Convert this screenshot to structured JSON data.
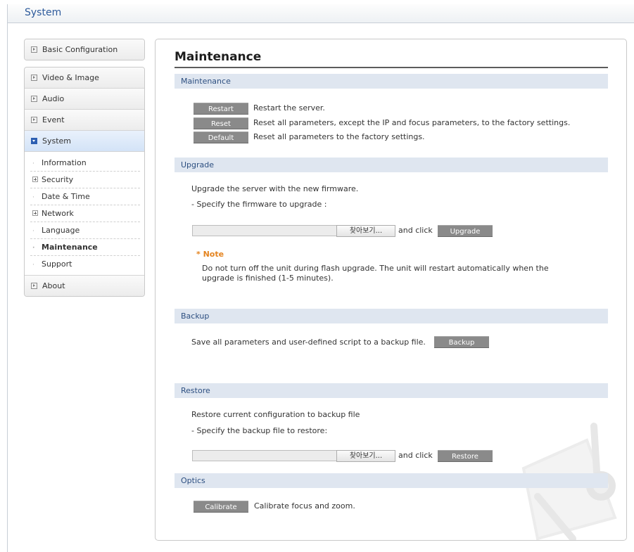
{
  "header": {
    "title": "System"
  },
  "sidebar": {
    "groups": [
      {
        "items": [
          {
            "label": "Basic Configuration"
          }
        ]
      },
      {
        "items": [
          {
            "label": "Video & Image"
          },
          {
            "label": "Audio"
          },
          {
            "label": "Event"
          },
          {
            "label": "System"
          }
        ],
        "submenu": [
          {
            "label": "Information"
          },
          {
            "label": "Security"
          },
          {
            "label": "Date & Time"
          },
          {
            "label": "Network"
          },
          {
            "label": "Language"
          },
          {
            "label": "Maintenance"
          },
          {
            "label": "Support"
          }
        ],
        "after": [
          {
            "label": "About"
          }
        ]
      }
    ]
  },
  "main": {
    "title": "Maintenance",
    "maintenance": {
      "heading": "Maintenance",
      "restart_label": "Restart",
      "restart_desc": "Restart the server.",
      "reset_label": "Reset",
      "reset_desc": "Reset all parameters, except the IP and focus parameters, to the factory settings.",
      "default_label": "Default",
      "default_desc": "Reset all parameters to the factory settings."
    },
    "upgrade": {
      "heading": "Upgrade",
      "line1": "Upgrade the server with the new firmware.",
      "line2": "- Specify the firmware to upgrade :",
      "browse_label": "찾아보기...",
      "and_click": "and click",
      "button_label": "Upgrade",
      "note_title": "* Note",
      "note_text": "Do not turn off the unit during flash upgrade. The unit will restart automatically when the upgrade is finished (1-5 minutes)."
    },
    "backup": {
      "heading": "Backup",
      "text": "Save all parameters and user-defined script to a backup file.",
      "button_label": "Backup"
    },
    "restore": {
      "heading": "Restore",
      "line1": "Restore current configuration to backup file",
      "line2": "- Specify the backup file to restore:",
      "browse_label": "찾아보기...",
      "and_click": "and click",
      "button_label": "Restore"
    },
    "optics": {
      "heading": "Optics",
      "button_label": "Calibrate",
      "desc": "Calibrate focus and zoom."
    }
  }
}
